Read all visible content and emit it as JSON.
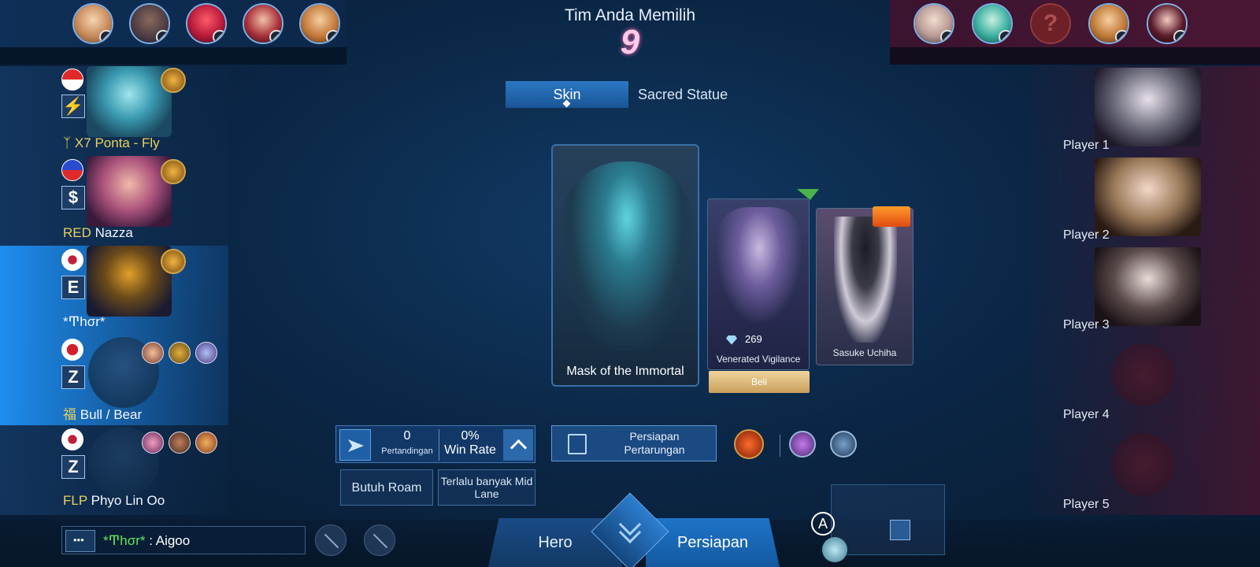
{
  "header": {
    "title": "Tim Anda Memilih",
    "countdown": "9"
  },
  "bans": {
    "left": [
      "ban-1",
      "ban-2",
      "ban-3",
      "ban-4",
      "ban-5"
    ],
    "right_unknown": "?"
  },
  "tabs": {
    "skin": "Skin",
    "sacred_statue": "Sacred Statue"
  },
  "team": [
    {
      "tag": "ᛉ X7 Ponta - Fly",
      "spell": "⚡"
    },
    {
      "tag": "RED",
      "name": "Nazza",
      "spell": "$"
    },
    {
      "name": "*Ͳhσr*",
      "spell": "E"
    },
    {
      "tag": "福",
      "name": "Bull / Bear",
      "spell": "Z"
    },
    {
      "tag": "FLP",
      "name": "Phyo Lin Oo",
      "spell": "Z"
    }
  ],
  "enemies": [
    "Player 1",
    "Player 2",
    "Player 3",
    "Player 4",
    "Player 5"
  ],
  "skins": {
    "main": "Mask of the Immortal",
    "second": {
      "name": "Venerated Vigilance",
      "price": "269",
      "buy": "Beli"
    },
    "third": {
      "name": "Sasuke Uchiha"
    }
  },
  "stats": {
    "matches": "0",
    "matches_label": "Pertandingan",
    "win_rate": "0%",
    "win_rate_label": "Win Rate"
  },
  "chips": {
    "chip1": "Butuh Roam",
    "chip2": "Terlalu banyak Mid Lane"
  },
  "prep_battle": "Persiapan Pertarungan",
  "chat": {
    "name": "*Ͳhσr*",
    "message": " : Aigoo"
  },
  "bottom_tabs": {
    "hero": "Hero",
    "prep": "Persiapan"
  },
  "map_badge": "A",
  "colors": {
    "accent": "#1e8df0",
    "chat_name": "#5ee858",
    "tag_gold": "#e9d15c"
  }
}
